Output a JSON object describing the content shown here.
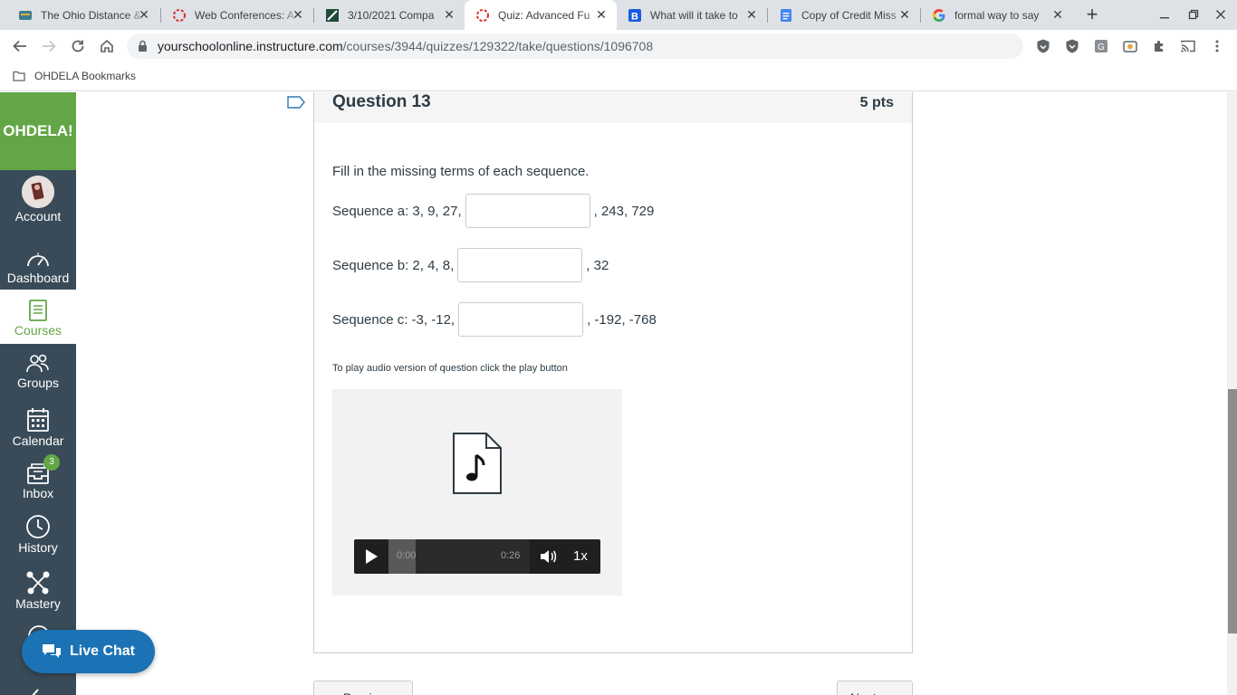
{
  "browser": {
    "tabs": [
      {
        "title": "The Ohio Distance &",
        "favicon": "ohdela-icon"
      },
      {
        "title": "Web Conferences: A",
        "favicon": "canvas-icon"
      },
      {
        "title": "3/10/2021 Compa",
        "favicon": "zipgrade-icon"
      },
      {
        "title": "Quiz: Advanced Fu",
        "favicon": "canvas-icon",
        "active": true
      },
      {
        "title": "What will it take to",
        "favicon": "brainly-icon"
      },
      {
        "title": "Copy of Credit Miss",
        "favicon": "docs-icon"
      },
      {
        "title": "formal way to say",
        "favicon": "google-icon"
      }
    ],
    "url_host": "yourschoolonline.instructure.com",
    "url_path": "/courses/3944/quizzes/129322/take/questions/1096708",
    "bookmark_folder": "OHDELA Bookmarks"
  },
  "gnav": {
    "logo": "OHDELA!",
    "items": [
      {
        "label": "Account",
        "icon": "avatar-icon"
      },
      {
        "label": "Dashboard",
        "icon": "dashboard-icon"
      },
      {
        "label": "Courses",
        "icon": "courses-icon",
        "active": true
      },
      {
        "label": "Groups",
        "icon": "groups-icon"
      },
      {
        "label": "Calendar",
        "icon": "calendar-icon"
      },
      {
        "label": "Inbox",
        "icon": "inbox-icon",
        "badge": "3"
      },
      {
        "label": "History",
        "icon": "history-icon"
      },
      {
        "label": "Mastery",
        "icon": "mastery-icon"
      }
    ]
  },
  "live_chat": {
    "label": "Live Chat"
  },
  "question": {
    "name": "Question 13",
    "points": "5 pts",
    "prompt": "Fill in the missing terms of each sequence.",
    "sequences": [
      {
        "before": "Sequence a: 3, 9, 27,",
        "after": ", 243, 729",
        "value": ""
      },
      {
        "before": "Sequence b: 2, 4, 8,",
        "after": ", 32",
        "value": ""
      },
      {
        "before": "Sequence c: -3, -12,",
        "after": ", -192, -768",
        "value": ""
      }
    ],
    "audio_note": "To play audio version of question click the play button"
  },
  "audio_player": {
    "current_time": "0:00",
    "duration": "0:26",
    "speed": "1x",
    "buffered_fraction": 0.19
  },
  "nav_buttons": {
    "previous": "◄ Previous",
    "next": "Next ►"
  },
  "colors": {
    "brand_green": "#62a646",
    "nav_bg": "#394b58",
    "live_chat": "#1b72b4"
  }
}
